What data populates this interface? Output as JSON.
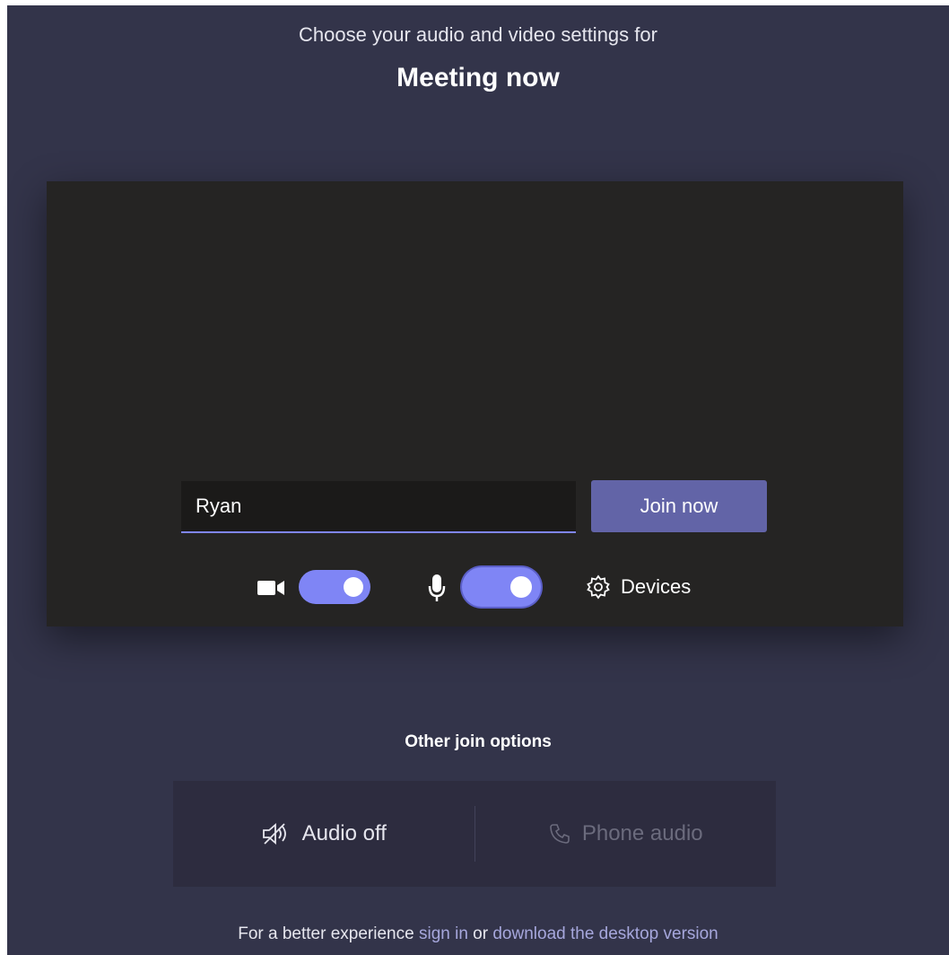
{
  "header": {
    "subtitle": "Choose your audio and video settings for",
    "title": "Meeting now"
  },
  "prejoin": {
    "name_value": "Ryan",
    "join_label": "Join now",
    "video_toggle_on": true,
    "audio_toggle_on": true,
    "devices_label": "Devices",
    "icons": {
      "camera": "camera-icon",
      "mic": "microphone-icon",
      "devices": "gear-icon"
    }
  },
  "other_options": {
    "title": "Other join options",
    "audio_off_label": "Audio off",
    "phone_audio_label": "Phone audio",
    "icons": {
      "audio_off": "speaker-off-icon",
      "phone_audio": "phone-icon"
    }
  },
  "footer": {
    "prefix": "For a better experience",
    "sign_in": "sign in",
    "or": "or",
    "download": "download the desktop version"
  },
  "colors": {
    "background": "#33344a",
    "preview": "#252423",
    "accent": "#6264a7",
    "toggle": "#7f85f5",
    "link": "#a6a7dc"
  }
}
